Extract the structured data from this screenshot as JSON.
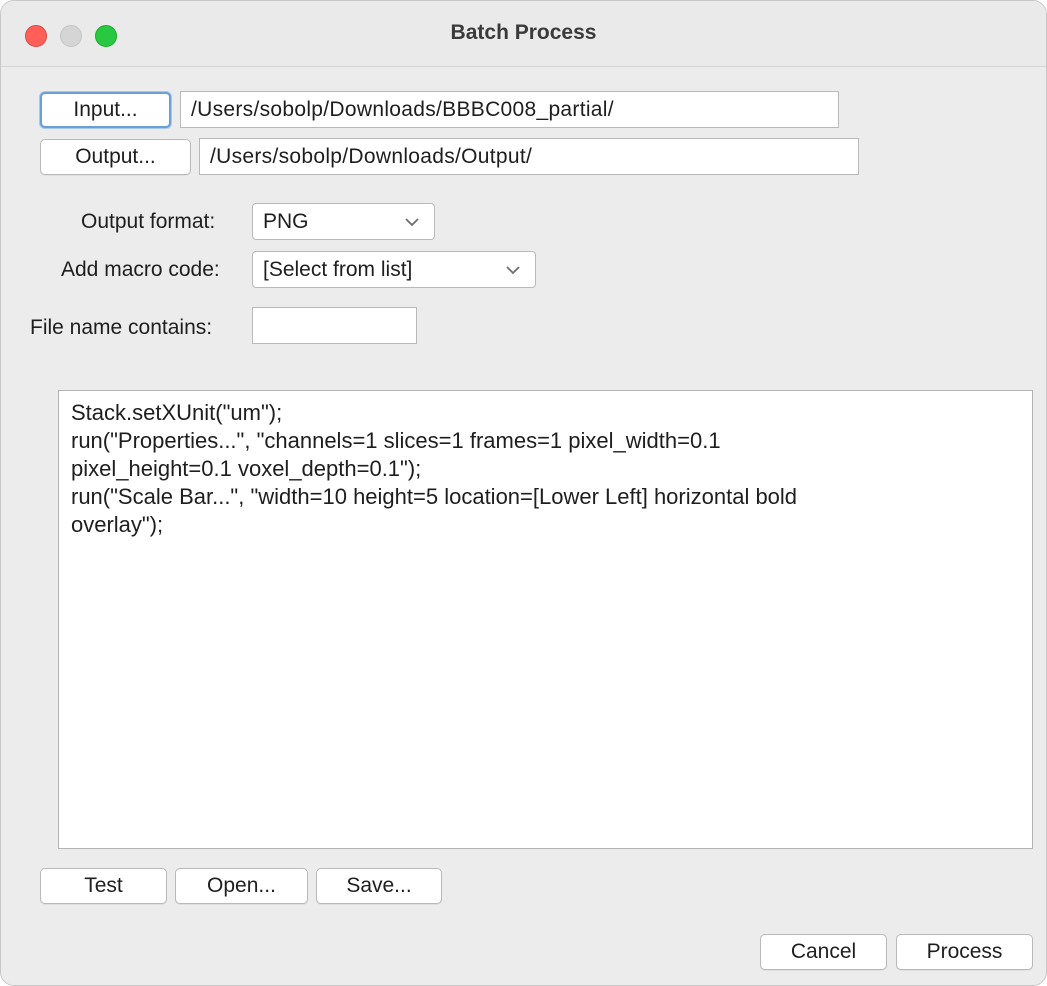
{
  "window": {
    "title": "Batch Process"
  },
  "paths": {
    "input_button": "Input...",
    "input_value": "/Users/sobolp/Downloads/BBBC008_partial/",
    "output_button": "Output...",
    "output_value": "/Users/sobolp/Downloads/Output/"
  },
  "options": {
    "output_format_label": "Output format:",
    "output_format_value": "PNG",
    "macro_label": "Add macro code:",
    "macro_value": "[Select from list]",
    "filename_label": "File name contains:",
    "filename_value": ""
  },
  "macro": {
    "code": "Stack.setXUnit(\"um\");\nrun(\"Properties...\", \"channels=1 slices=1 frames=1 pixel_width=0.1\npixel_height=0.1 voxel_depth=0.1\");\nrun(\"Scale Bar...\", \"width=10 height=5 location=[Lower Left] horizontal bold\noverlay\");"
  },
  "buttons": {
    "test": "Test",
    "open": "Open...",
    "save": "Save...",
    "cancel": "Cancel",
    "process": "Process"
  },
  "icons": {
    "dropdown": "chevron-down-icon"
  },
  "colors": {
    "close": "#ff5f57",
    "minimize": "#d5d5d5",
    "zoom": "#28c840",
    "focus_ring": "#6a9fd4"
  }
}
